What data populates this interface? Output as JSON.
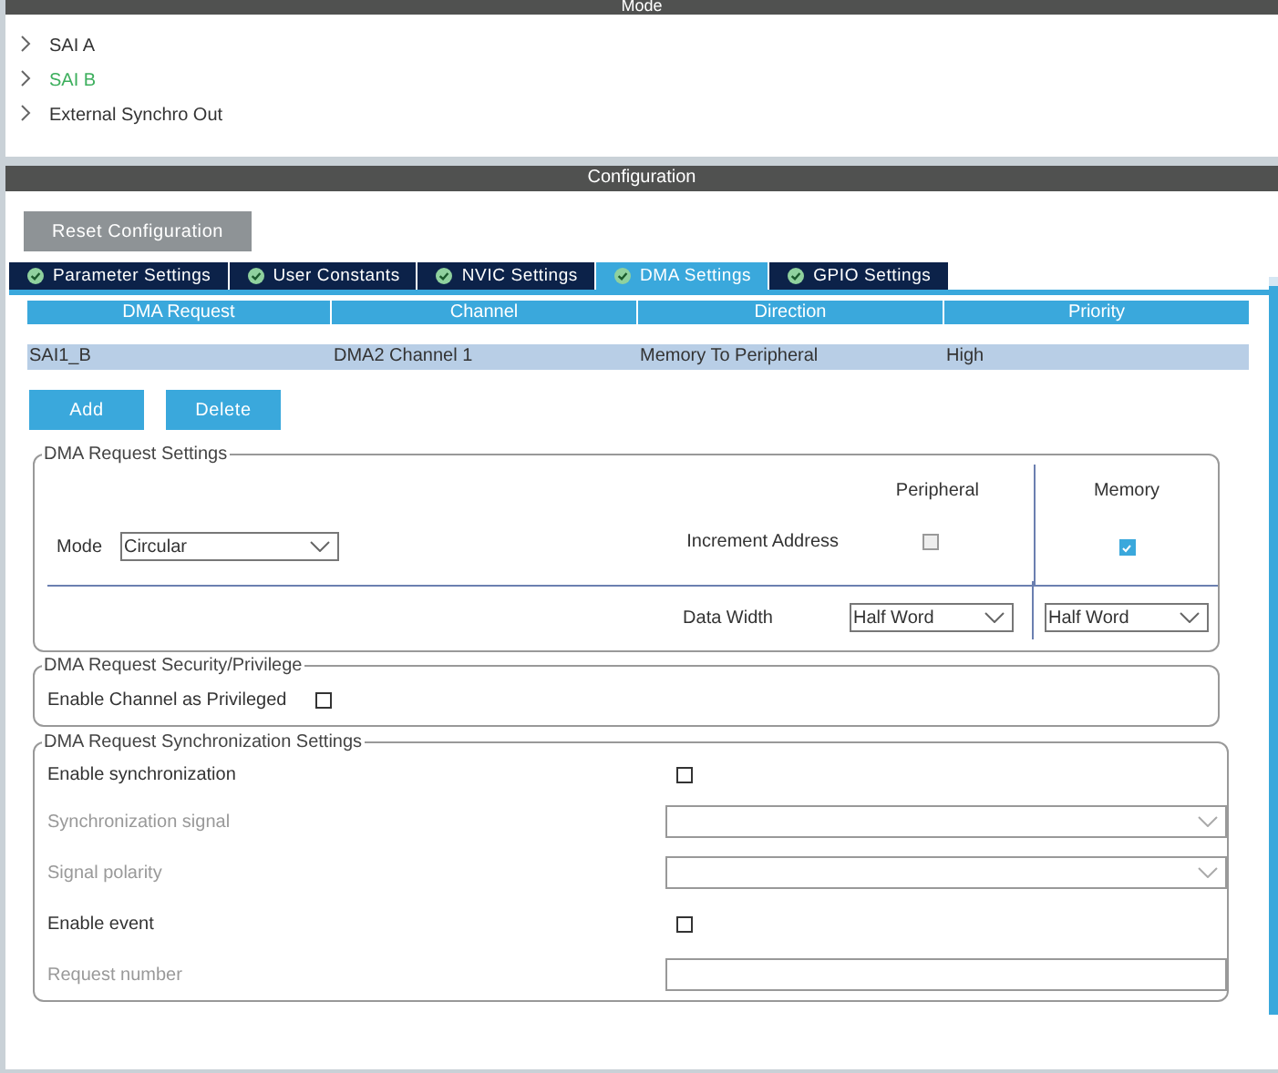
{
  "mode_panel": {
    "title": "Mode",
    "items": [
      {
        "label": "SAI A",
        "selected": false
      },
      {
        "label": "SAI B",
        "selected": true
      },
      {
        "label": "External Synchro Out",
        "selected": false
      }
    ]
  },
  "configuration": {
    "title": "Configuration",
    "reset_button": "Reset Configuration",
    "tabs": [
      {
        "label": "Parameter Settings",
        "selected": false
      },
      {
        "label": "User Constants",
        "selected": false
      },
      {
        "label": "NVIC Settings",
        "selected": false
      },
      {
        "label": "DMA Settings",
        "selected": true
      },
      {
        "label": "GPIO Settings",
        "selected": false
      }
    ],
    "table": {
      "columns": [
        "DMA Request",
        "Channel",
        "Direction",
        "Priority"
      ],
      "rows": [
        [
          "SAI1_B",
          "DMA2 Channel 1",
          "Memory To Peripheral",
          "High"
        ]
      ]
    },
    "buttons": [
      "Add",
      "Delete"
    ],
    "request_settings": {
      "title": "DMA Request Settings",
      "mode_label": "Mode",
      "mode_value": "Circular",
      "peripheral_header": "Peripheral",
      "memory_header": "Memory",
      "increment_label": "Increment Address",
      "peripheral_increment": false,
      "memory_increment": true,
      "data_width_label": "Data Width",
      "peripheral_width": "Half Word",
      "memory_width": "Half Word"
    },
    "security": {
      "title": "DMA Request Security/Privilege",
      "label": "Enable Channel as Privileged",
      "checked": false
    },
    "sync": {
      "title": "DMA Request Synchronization Settings",
      "rows": [
        {
          "kind": "checkbox",
          "label": "Enable synchronization",
          "disabled": false,
          "checked": false
        },
        {
          "kind": "select",
          "label": "Synchronization signal",
          "disabled": true
        },
        {
          "kind": "select",
          "label": "Signal polarity",
          "disabled": true
        },
        {
          "kind": "checkbox",
          "label": "Enable event",
          "disabled": false,
          "checked": false
        },
        {
          "kind": "input",
          "label": "Request number",
          "disabled": true
        }
      ]
    }
  }
}
